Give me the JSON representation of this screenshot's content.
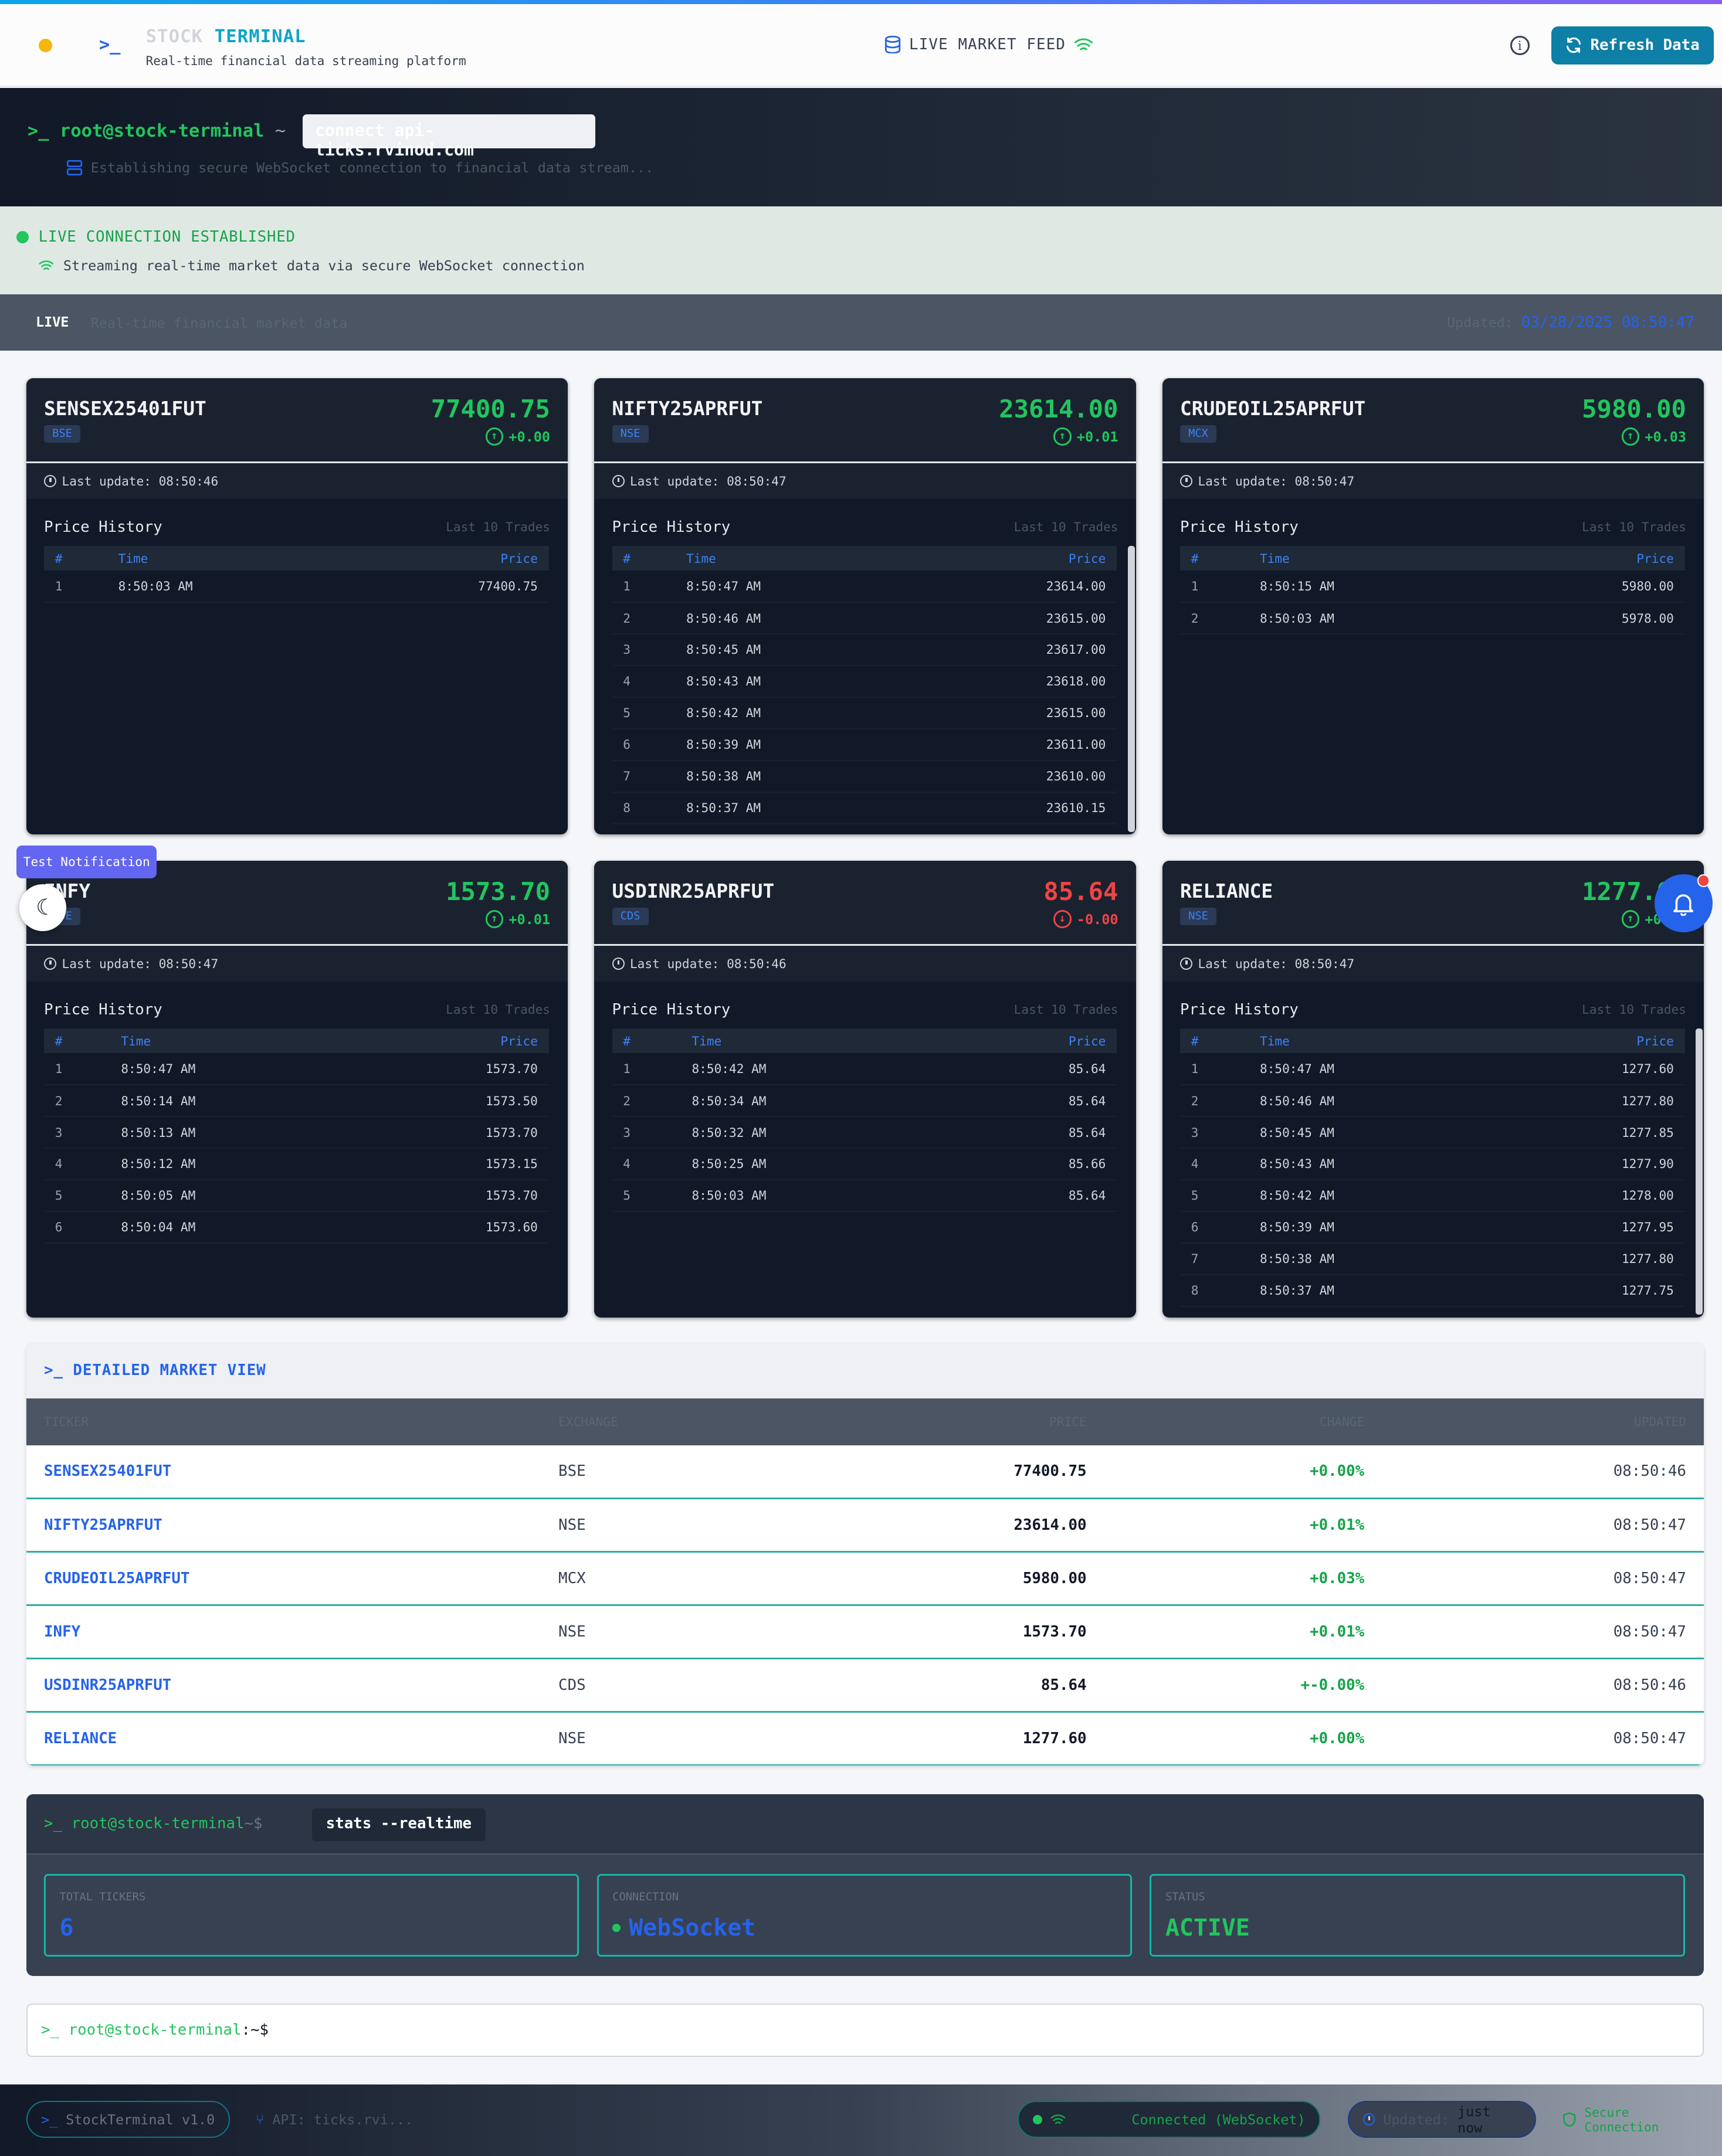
{
  "header": {
    "brand_a": "STOCK",
    "brand_b": "TERMINAL",
    "tagline": "Real-time financial data streaming platform",
    "feed": "LIVE MARKET FEED",
    "refresh": "Refresh Data",
    "terminal_icon": "terminal-icon",
    "database_icon": "database-icon",
    "wifi_icon": "wifi-icon",
    "info_icon": "info-icon"
  },
  "command": {
    "prompt": "root@stock-terminal",
    "tilde": "~",
    "command": "connect api-ticks.rvinod.com",
    "status": "Establishing secure WebSocket connection to financial data stream..."
  },
  "connection": {
    "title": "LIVE CONNECTION ESTABLISHED",
    "subtitle": "Streaming real-time market data via secure WebSocket connection"
  },
  "livebar": {
    "live": "LIVE",
    "subtitle": "Real-time financial market data",
    "updated_label": "Updated:",
    "updated_value": "03/28/2025 08:50:47"
  },
  "cards": [
    {
      "symbol": "SENSEX25401FUT",
      "exchange": "BSE",
      "price": "77400.75",
      "change": "+0.00",
      "dir": "up",
      "last_update": "Last update: 08:50:46",
      "rows": [
        [
          "1",
          "8:50:03 AM",
          "77400.75",
          "g"
        ]
      ]
    },
    {
      "symbol": "NIFTY25APRFUT",
      "exchange": "NSE",
      "price": "23614.00",
      "change": "+0.01",
      "dir": "up",
      "last_update": "Last update: 08:50:47",
      "rows": [
        [
          "1",
          "8:50:47 AM",
          "23614.00",
          "r"
        ],
        [
          "2",
          "8:50:46 AM",
          "23615.00",
          "r"
        ],
        [
          "3",
          "8:50:45 AM",
          "23617.00",
          "r"
        ],
        [
          "4",
          "8:50:43 AM",
          "23618.00",
          "g"
        ],
        [
          "5",
          "8:50:42 AM",
          "23615.00",
          "g"
        ],
        [
          "6",
          "8:50:39 AM",
          "23611.00",
          "g"
        ],
        [
          "7",
          "8:50:38 AM",
          "23610.00",
          "r"
        ],
        [
          "8",
          "8:50:37 AM",
          "23610.15",
          "g"
        ]
      ]
    },
    {
      "symbol": "CRUDEOIL25APRFUT",
      "exchange": "MCX",
      "price": "5980.00",
      "change": "+0.03",
      "dir": "up",
      "last_update": "Last update: 08:50:47",
      "rows": [
        [
          "1",
          "8:50:15 AM",
          "5980.00",
          "g"
        ],
        [
          "2",
          "8:50:03 AM",
          "5978.00",
          "g"
        ]
      ]
    },
    {
      "symbol": "INFY",
      "exchange": "NSE",
      "price": "1573.70",
      "change": "+0.01",
      "dir": "up",
      "last_update": "Last update: 08:50:47",
      "rows": [
        [
          "1",
          "8:50:47 AM",
          "1573.70",
          "g"
        ],
        [
          "2",
          "8:50:14 AM",
          "1573.50",
          "r"
        ],
        [
          "3",
          "8:50:13 AM",
          "1573.70",
          "g"
        ],
        [
          "4",
          "8:50:12 AM",
          "1573.15",
          "r"
        ],
        [
          "5",
          "8:50:05 AM",
          "1573.70",
          "g"
        ],
        [
          "6",
          "8:50:04 AM",
          "1573.60",
          "g"
        ]
      ]
    },
    {
      "symbol": "USDINR25APRFUT",
      "exchange": "CDS",
      "price": "85.64",
      "change": "-0.00",
      "dir": "down",
      "last_update": "Last update: 08:50:46",
      "rows": [
        [
          "1",
          "8:50:42 AM",
          "85.64",
          "r"
        ],
        [
          "2",
          "8:50:34 AM",
          "85.64",
          "r"
        ],
        [
          "3",
          "8:50:32 AM",
          "85.64",
          "r"
        ],
        [
          "4",
          "8:50:25 AM",
          "85.66",
          "g"
        ],
        [
          "5",
          "8:50:03 AM",
          "85.64",
          "g"
        ]
      ]
    },
    {
      "symbol": "RELIANCE",
      "exchange": "NSE",
      "price": "1277.60",
      "change": "+0.00",
      "dir": "up",
      "last_update": "Last update: 08:50:47",
      "rows": [
        [
          "1",
          "8:50:47 AM",
          "1277.60",
          "r"
        ],
        [
          "2",
          "8:50:46 AM",
          "1277.80",
          "r"
        ],
        [
          "3",
          "8:50:45 AM",
          "1277.85",
          "r"
        ],
        [
          "4",
          "8:50:43 AM",
          "1277.90",
          "r"
        ],
        [
          "5",
          "8:50:42 AM",
          "1278.00",
          "g"
        ],
        [
          "6",
          "8:50:39 AM",
          "1277.95",
          "g"
        ],
        [
          "7",
          "8:50:38 AM",
          "1277.80",
          "g"
        ],
        [
          "8",
          "8:50:37 AM",
          "1277.75",
          "r"
        ]
      ]
    }
  ],
  "card_labels": {
    "price_history": "Price History",
    "last10": "Last 10 Trades",
    "col_num": "#",
    "col_time": "Time",
    "col_price": "Price"
  },
  "floating": {
    "test_notification": "Test Notification",
    "moon_icon": "moon-icon",
    "bell_icon": "bell-icon"
  },
  "detail": {
    "title": "DETAILED MARKET VIEW",
    "headers": [
      "TICKER",
      "EXCHANGE",
      "PRICE",
      "CHANGE",
      "UPDATED"
    ],
    "rows": [
      [
        "SENSEX25401FUT",
        "BSE",
        "77400.75",
        "+0.00%",
        "08:50:46"
      ],
      [
        "NIFTY25APRFUT",
        "NSE",
        "23614.00",
        "+0.01%",
        "08:50:47"
      ],
      [
        "CRUDEOIL25APRFUT",
        "MCX",
        "5980.00",
        "+0.03%",
        "08:50:47"
      ],
      [
        "INFY",
        "NSE",
        "1573.70",
        "+0.01%",
        "08:50:47"
      ],
      [
        "USDINR25APRFUT",
        "CDS",
        "85.64",
        "+-0.00%",
        "08:50:46"
      ],
      [
        "RELIANCE",
        "NSE",
        "1277.60",
        "+0.00%",
        "08:50:47"
      ]
    ]
  },
  "stats": {
    "prompt": "root@stock-terminal",
    "path": "~$",
    "command": "stats --realtime",
    "total_label": "TOTAL TICKERS",
    "total_value": "6",
    "conn_label": "CONNECTION",
    "conn_value": "WebSocket",
    "status_label": "STATUS",
    "status_value": "ACTIVE"
  },
  "prompt2": {
    "user": "root@stock-terminal",
    "path": ":~$"
  },
  "footer": {
    "version": "StockTerminal v1.0",
    "api": "API: ticks.rvi...",
    "connected": "Connected (WebSocket)",
    "updated_label": "Updated:",
    "updated_value": "just now",
    "secure": "Secure Connection"
  }
}
